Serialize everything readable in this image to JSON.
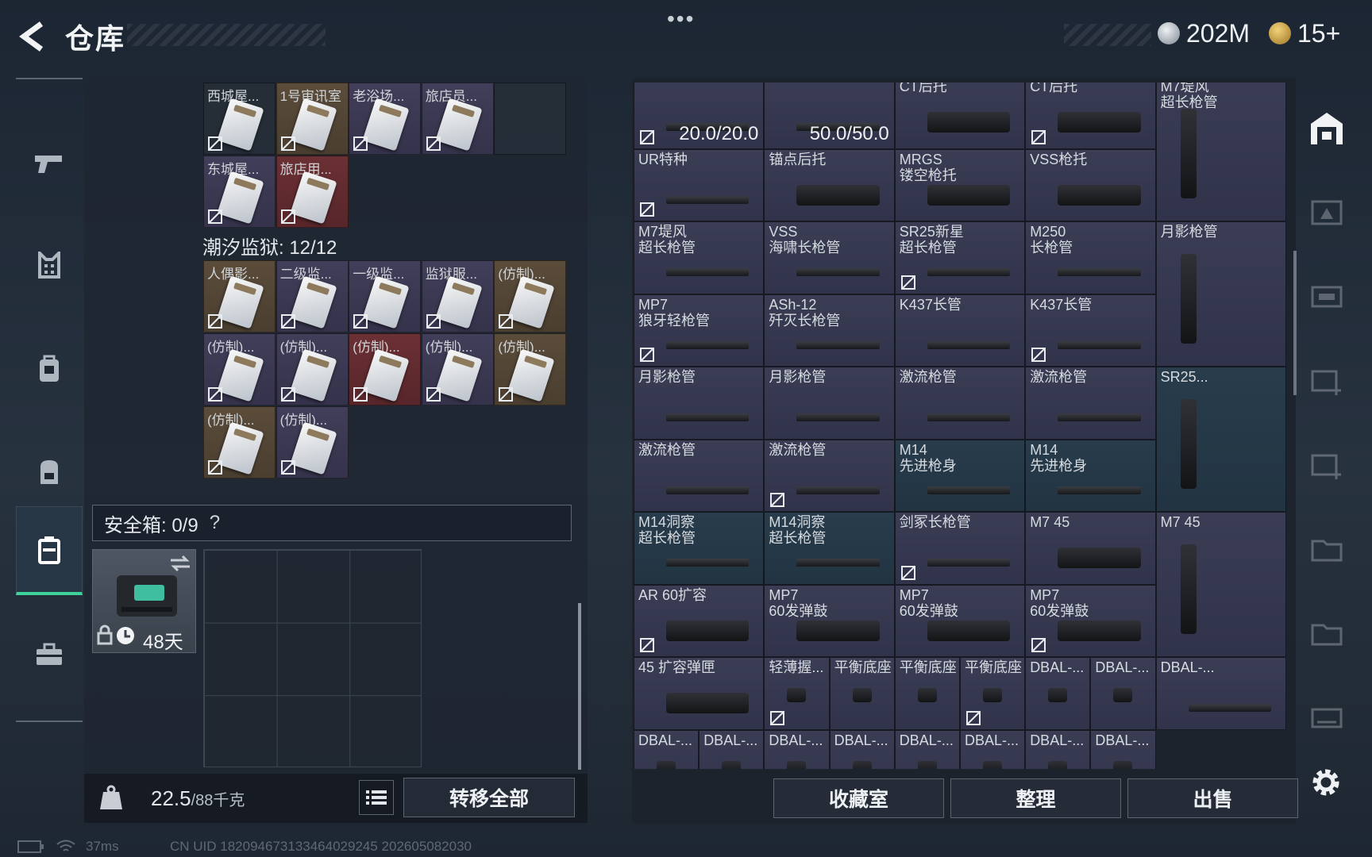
{
  "header": {
    "title": "仓库",
    "more": "•••",
    "currency1": "202M",
    "currency2": "15+"
  },
  "left_nav": [
    "weapon-icon",
    "armor-icon",
    "vest-icon",
    "backpack-icon",
    "container-icon",
    "case-icon"
  ],
  "stash_top": {
    "row1": [
      {
        "name": "西城屋...",
        "bg": "empty"
      },
      {
        "name": "1号审讯室",
        "bg": "gold"
      },
      {
        "name": "老浴场...",
        "bg": "purple"
      },
      {
        "name": "旅店员...",
        "bg": "purple"
      }
    ],
    "row2": [
      {
        "name": "东城屋...",
        "bg": "purple"
      },
      {
        "name": "旅店用...",
        "bg": "red"
      }
    ]
  },
  "prison": {
    "label": "潮汐监狱: 12/12",
    "items": [
      {
        "name": "人偶影...",
        "bg": "gold"
      },
      {
        "name": "二级监...",
        "bg": "purple"
      },
      {
        "name": "一级监...",
        "bg": "purple"
      },
      {
        "name": "监狱服...",
        "bg": "purple"
      },
      {
        "name": "(仿制)...",
        "bg": "gold"
      },
      {
        "name": "(仿制)...",
        "bg": "purple"
      },
      {
        "name": "(仿制)...",
        "bg": "purple"
      },
      {
        "name": "(仿制)...",
        "bg": "red"
      },
      {
        "name": "(仿制)...",
        "bg": "purple"
      },
      {
        "name": "(仿制)...",
        "bg": "gold"
      },
      {
        "name": "(仿制)...",
        "bg": "gold"
      },
      {
        "name": "(仿制)...",
        "bg": "purple"
      }
    ]
  },
  "safebox": {
    "label": "安全箱: 0/9",
    "help": "?",
    "days": "48天"
  },
  "weight": {
    "value": "22.5",
    "max": "/88千克",
    "transfer": "转移全部"
  },
  "status": {
    "ms": "37ms",
    "uid": "CN UID 1820946731334640292​45 202605082030"
  },
  "warehouse": [
    {
      "name": "",
      "dur": "20.0/20.0",
      "bg": "p",
      "noicon": true
    },
    {
      "name": "",
      "dur": "50.0/50.0",
      "bg": "p"
    },
    {
      "name": "CT后托",
      "bg": "p"
    },
    {
      "name": "CT后托",
      "bg": "p",
      "noicon": true
    },
    {
      "name": "M7堤风\n超长枪管",
      "bg": "p"
    },
    {
      "name": "UR特种",
      "bg": "p",
      "noicon": true
    },
    {
      "name": "锚点后托",
      "bg": "p"
    },
    {
      "name": "MRGS\n镂空枪托",
      "bg": "p"
    },
    {
      "name": "VSS枪托",
      "bg": "p"
    },
    {
      "name": "",
      "bg": "p"
    },
    {
      "name": "M7堤风\n超长枪管",
      "bg": "p"
    },
    {
      "name": "VSS\n海啸长枪管",
      "bg": "p"
    },
    {
      "name": "SR25新星\n超长枪管",
      "bg": "p",
      "noicon": true
    },
    {
      "name": "M250\n长枪管",
      "bg": "p"
    },
    {
      "name": "月影枪管",
      "bg": "p"
    },
    {
      "name": "MP7\n狼牙轻枪管",
      "bg": "p",
      "noicon": true
    },
    {
      "name": "ASh-12\n歼灭长枪管",
      "bg": "p"
    },
    {
      "name": "K437长管",
      "bg": "p"
    },
    {
      "name": "K437长管",
      "bg": "p",
      "noicon": true
    },
    {
      "name": "月影枪管",
      "bg": "p"
    },
    {
      "name": "月影枪管",
      "bg": "p"
    },
    {
      "name": "激流枪管",
      "bg": "p"
    },
    {
      "name": "激流枪管",
      "bg": "p"
    },
    {
      "name": "SR25...",
      "bg": "b"
    },
    {
      "name": "激流枪管",
      "bg": "p"
    },
    {
      "name": "激流枪管",
      "bg": "p",
      "noicon": true
    },
    {
      "name": "M14\n先进枪身",
      "bg": "b"
    },
    {
      "name": "M14\n先进枪身",
      "bg": "b"
    },
    {
      "name": "M14洞察\n超长枪管",
      "bg": "b"
    },
    {
      "name": "M14洞察\n超长枪管",
      "bg": "b"
    },
    {
      "name": "剑冢长枪管",
      "bg": "p",
      "noicon": true
    },
    {
      "name": "M7 45",
      "bg": "p"
    },
    {
      "name": "M7 45",
      "bg": "p"
    },
    {
      "name": "AR 60扩容",
      "bg": "p",
      "noicon": true
    },
    {
      "name": "MP7\n60发弹鼓",
      "bg": "p"
    },
    {
      "name": "MP7\n60发弹鼓",
      "bg": "p"
    },
    {
      "name": "MP7\n60发弹鼓",
      "bg": "p",
      "noicon": true
    },
    {
      "name": "45 扩容弹匣",
      "bg": "p"
    },
    {
      "name": "轻薄握...",
      "bg": "p",
      "noicon": true
    },
    {
      "name": "平衡底座",
      "bg": "p"
    },
    {
      "name": "平衡底座",
      "bg": "p"
    },
    {
      "name": "平衡底座",
      "bg": "p",
      "noicon": true
    },
    {
      "name": "DBAL-...",
      "bg": "p"
    },
    {
      "name": "DBAL-...",
      "bg": "p"
    },
    {
      "name": "DBAL-...",
      "bg": "p"
    },
    {
      "name": "DBAL-...",
      "bg": "p"
    },
    {
      "name": "DBAL-...",
      "bg": "p"
    },
    {
      "name": "DBAL-...",
      "bg": "p"
    },
    {
      "name": "DBAL-...",
      "bg": "p"
    },
    {
      "name": "DBAL-...",
      "bg": "p"
    },
    {
      "name": "DBAL-...",
      "bg": "p"
    },
    {
      "name": "DBAL-...",
      "bg": "p"
    },
    {
      "name": "DBAL-...",
      "bg": "p"
    }
  ],
  "bottom_buttons": {
    "collection": "收藏室",
    "sort": "整理",
    "sell": "出售"
  },
  "right_tabs": [
    "warehouse-icon",
    "gti-icon-1",
    "gti-icon-2",
    "iv-icon-1",
    "iv-icon-2",
    "iv-icon-3",
    "iv-icon-4",
    "gti-icon-3"
  ],
  "colors": {
    "accent": "#3fd19a"
  }
}
